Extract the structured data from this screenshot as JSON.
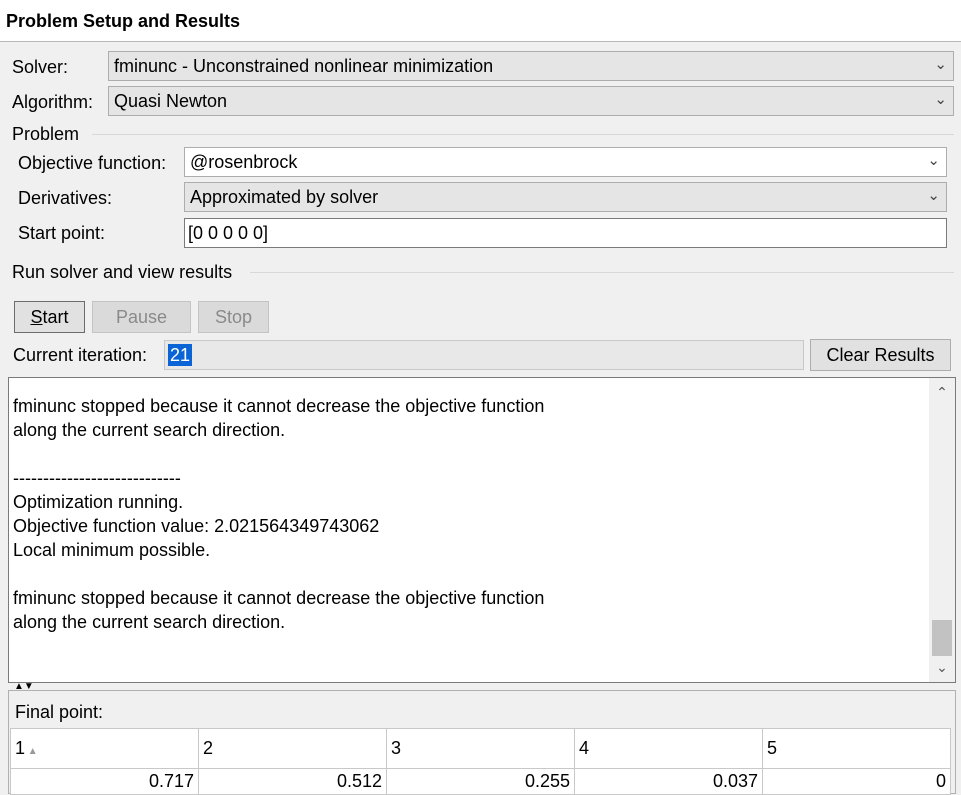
{
  "panel": {
    "title": "Problem Setup and Results"
  },
  "solver": {
    "label": "Solver:",
    "value": "fminunc - Unconstrained nonlinear minimization"
  },
  "algorithm": {
    "label": "Algorithm:",
    "value": "Quasi Newton"
  },
  "problem": {
    "heading": "Problem",
    "objective_label": "Objective function:",
    "objective_value": "@rosenbrock",
    "derivatives_label": "Derivatives:",
    "derivatives_value": "Approximated by solver",
    "start_label": "Start point:",
    "start_value": "[0 0 0 0 0]"
  },
  "run": {
    "heading": "Run solver and view results",
    "start_button": "Start",
    "pause_button": "Pause",
    "stop_button": "Stop",
    "iteration_label": "Current iteration:",
    "iteration_value": "21",
    "clear_button": "Clear Results"
  },
  "output": {
    "lines": [
      "fminunc stopped because it cannot decrease the objective function",
      "along the current search direction.",
      "",
      "----------------------------",
      "Optimization running.",
      "Objective function value: 2.021564349743062",
      "Local minimum possible.",
      "",
      "fminunc stopped because it cannot decrease the objective function",
      "along the current search direction."
    ]
  },
  "final_point": {
    "label": "Final point:",
    "columns": [
      "1",
      "2",
      "3",
      "4",
      "5"
    ],
    "values": [
      "0.717",
      "0.512",
      "0.255",
      "0.037",
      "0"
    ]
  },
  "icons": {
    "dropdown": "chevron-down-icon",
    "sort": "sort-ascending-icon",
    "splitter": "splitter-arrows-icon"
  }
}
